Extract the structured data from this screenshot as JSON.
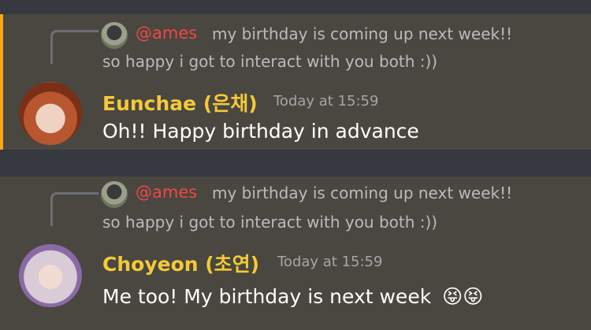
{
  "messages": [
    {
      "reply": {
        "mention": "@ames",
        "text_line1": "my birthday is coming up next week!!",
        "text_line2": "so happy i got to interact with you both :))"
      },
      "username": "Eunchae (은채)",
      "timestamp": "Today at 15:59",
      "content": "Oh!! Happy birthday in advance"
    },
    {
      "reply": {
        "mention": "@ames",
        "text_line1": "my birthday is coming up next week!!",
        "text_line2": "so happy i got to interact with you both :))"
      },
      "username": "Choyeon (초연)",
      "timestamp": "Today at 15:59",
      "content": "Me too! My birthday is next week",
      "emoji": "😝😝"
    }
  ],
  "colors": {
    "background": "#36393f",
    "message_highlight": "#4a4740",
    "accent_bar": "#faa61a",
    "username": "#f5c938",
    "mention": "#f04747"
  }
}
